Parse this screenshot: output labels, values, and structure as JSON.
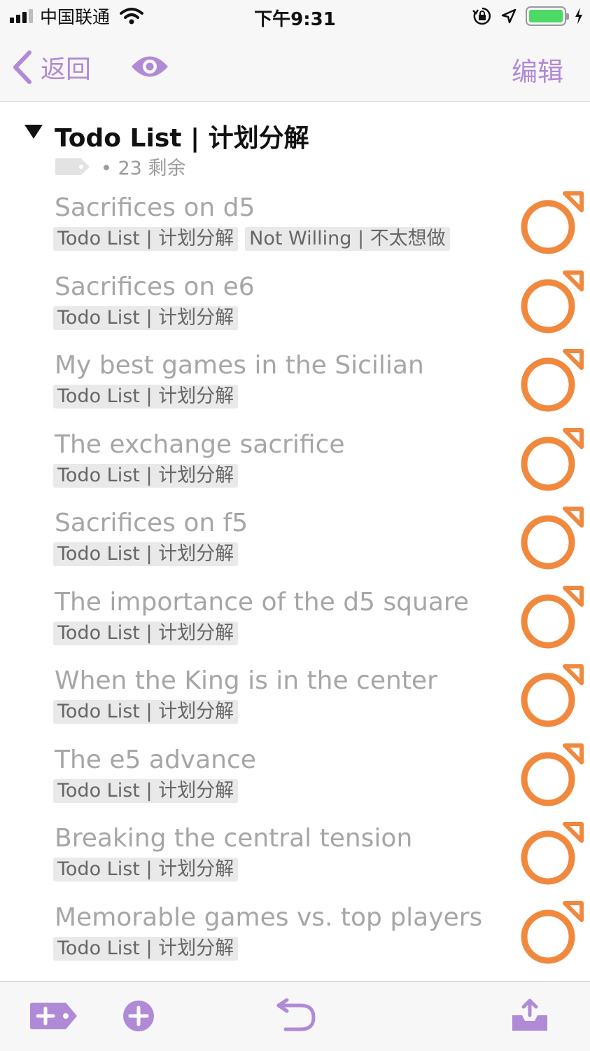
{
  "status_bar": {
    "carrier": "中国联通",
    "time": "下午9:31"
  },
  "nav": {
    "back_label": "返回",
    "edit_label": "编辑"
  },
  "group": {
    "title": "Todo List | 计划分解",
    "remaining": "• 23 剩余"
  },
  "items": [
    {
      "title": "Sacrifices on d5",
      "tags": [
        "Todo List | 计划分解",
        "Not Willing | 不太想做"
      ]
    },
    {
      "title": "Sacrifices on e6",
      "tags": [
        "Todo List | 计划分解"
      ]
    },
    {
      "title": "My best games in the Sicilian",
      "tags": [
        "Todo List | 计划分解"
      ]
    },
    {
      "title": "The exchange sacrifice",
      "tags": [
        "Todo List | 计划分解"
      ]
    },
    {
      "title": "Sacrifices on f5",
      "tags": [
        "Todo List | 计划分解"
      ]
    },
    {
      "title": "The importance of the d5 square",
      "tags": [
        "Todo List | 计划分解"
      ]
    },
    {
      "title": "When the King is in the center",
      "tags": [
        "Todo List | 计划分解"
      ]
    },
    {
      "title": "The e5 advance",
      "tags": [
        "Todo List | 计划分解"
      ]
    },
    {
      "title": "Breaking the central tension",
      "tags": [
        "Todo List | 计划分解"
      ]
    },
    {
      "title": "Memorable games vs. top players",
      "tags": [
        "Todo List | 计划分解"
      ]
    }
  ],
  "icons": {
    "back": "chevron-left-icon",
    "eye": "eye-icon",
    "disclosure": "triangle-down-icon",
    "tag": "tag-icon",
    "status": "flagged-circle-icon",
    "toolbar": [
      "add-tag-icon",
      "add-circle-icon",
      "undo-icon",
      "inbox-upload-icon"
    ]
  },
  "colors": {
    "accent": "#b08ad6",
    "status_orange": "#f0883e",
    "title_gray": "#a6a6a6",
    "tag_bg": "#e9e9e9",
    "battery_green": "#4cd964"
  }
}
